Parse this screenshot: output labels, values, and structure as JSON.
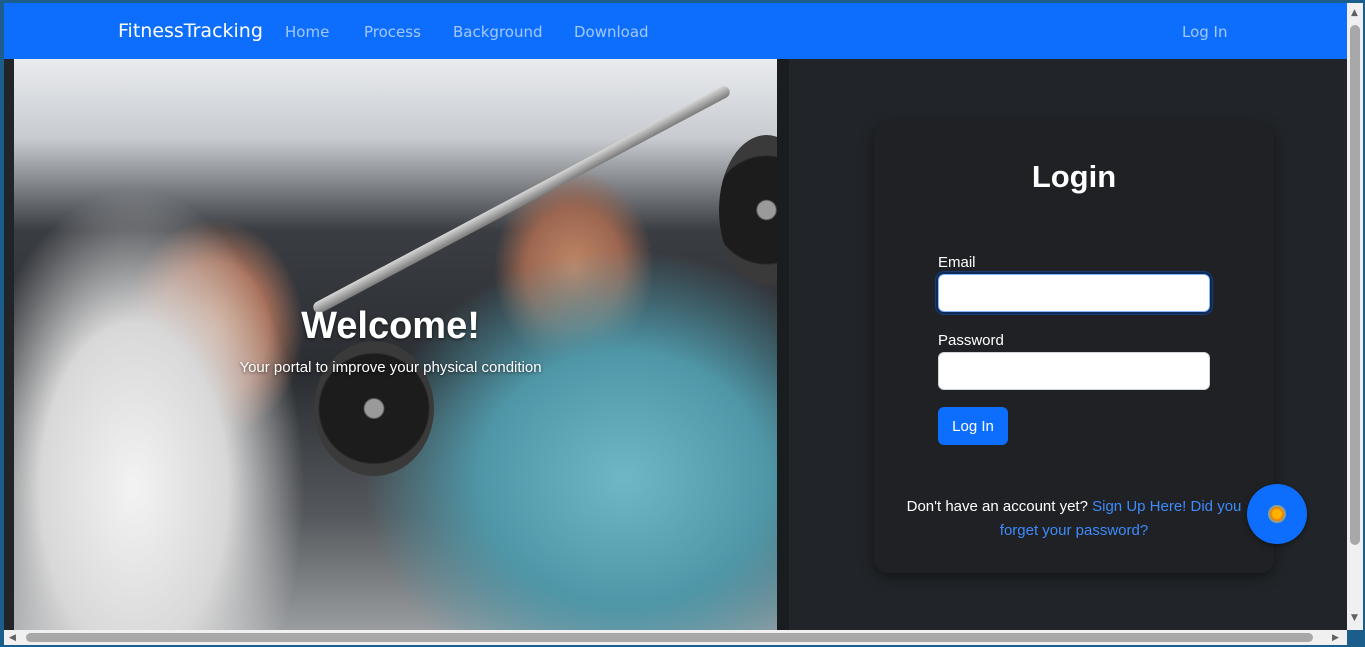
{
  "navbar": {
    "brand": "FitnessTracking",
    "links": [
      "Home",
      "Process",
      "Background",
      "Download"
    ],
    "login_link": "Log In"
  },
  "hero": {
    "title": "Welcome!",
    "subtitle": "Your portal to improve your physical condition"
  },
  "login_card": {
    "title": "Login",
    "email_label": "Email",
    "email_value": "",
    "password_label": "Password",
    "password_value": "",
    "submit_label": "Log In",
    "signup_prompt": "Don't have an account yet?",
    "signup_link": "Sign Up Here!",
    "forgot_link": "Did you forget your password?"
  },
  "fab": {
    "icon": "sun-icon"
  },
  "colors": {
    "primary": "#0d6efd",
    "dark_bg": "#212529",
    "card_bg": "#1f2124",
    "link": "#3d8bfd"
  }
}
